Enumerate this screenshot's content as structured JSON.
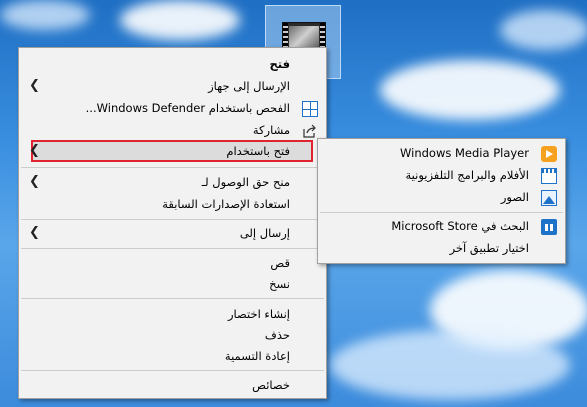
{
  "desktop": {
    "file_name": ""
  },
  "main_menu": {
    "items": [
      {
        "label": "فتح",
        "bold": true
      },
      {
        "label": "الإرسال إلى جهاز",
        "submenu": true
      },
      {
        "label": "الفحص باستخدام Windows Defender...",
        "icon": "windows-defender-icon"
      },
      {
        "label": "مشاركة",
        "icon": "share-icon"
      },
      {
        "label": "فتح باستخدام",
        "submenu": true,
        "highlighted": true
      },
      {
        "label": "منح حق الوصول لـ",
        "submenu": true
      },
      {
        "label": "استعادة الإصدارات السابقة"
      },
      {
        "label": "إرسال إلى",
        "submenu": true
      },
      {
        "label": "قص"
      },
      {
        "label": "نسخ"
      },
      {
        "label": "إنشاء اختصار"
      },
      {
        "label": "حذف"
      },
      {
        "label": "إعادة التسمية"
      },
      {
        "label": "خصائص"
      }
    ]
  },
  "open_with_menu": {
    "items": [
      {
        "label": "Windows Media Player",
        "icon": "media-player-icon"
      },
      {
        "label": "الأفلام والبرامج التلفزيونية",
        "icon": "movies-tv-icon"
      },
      {
        "label": "الصور",
        "icon": "photos-icon"
      },
      {
        "label": "البحث في Microsoft Store",
        "icon": "store-icon"
      },
      {
        "label": "اختيار تطبيق آخر"
      }
    ]
  },
  "colors": {
    "highlight_border": "#e0242f",
    "menu_bg": "#f2f2f2",
    "accent": "#1e73c8"
  }
}
